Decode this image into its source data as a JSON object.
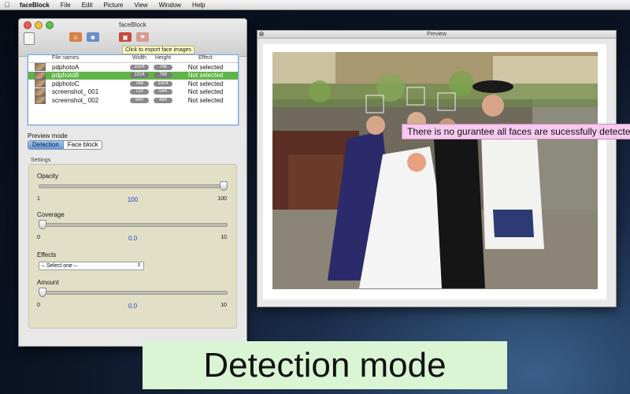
{
  "menubar": {
    "app_name": "faceBlock",
    "items": [
      "File",
      "Edit",
      "Picture",
      "View",
      "Window",
      "Help"
    ]
  },
  "main_window": {
    "title": "faceBlock",
    "tooltip": "Click to export face images",
    "table": {
      "headers": [
        "File names",
        "Width",
        "Height",
        "Effect"
      ],
      "rows": [
        {
          "name": "pdphotoA",
          "width": "1024",
          "height": "768",
          "effect": "Not selected"
        },
        {
          "name": "pdphotoB",
          "width": "1024",
          "height": "768",
          "effect": "Not selected"
        },
        {
          "name": "pdphotoC",
          "width": "768",
          "height": "1024",
          "effect": "Not selected"
        },
        {
          "name": "screenshot_ 001",
          "width": "720",
          "height": "544",
          "effect": "Not selected"
        },
        {
          "name": "screenshot_ 002",
          "width": "640",
          "height": "480",
          "effect": "Not selected"
        }
      ],
      "selected_row": 1
    },
    "preview_mode": {
      "label": "Preview mode",
      "options": [
        "Detection",
        "Face block"
      ],
      "active": "Detection"
    },
    "settings": {
      "label": "Settings",
      "opacity": {
        "label": "Opacity",
        "min": "1",
        "max": "100",
        "value": "100",
        "level": 1.0
      },
      "coverage": {
        "label": "Coverage",
        "min": "0",
        "max": "10",
        "value": "0.0",
        "level": 0.0
      },
      "effects": {
        "label": "Effects",
        "selected": "– Select one –"
      },
      "amount": {
        "label": "Amount",
        "min": "0",
        "max": "10",
        "value": "0.0",
        "level": 0.0
      }
    }
  },
  "preview_window": {
    "title": "Preview"
  },
  "callout": "There is no gurantee all faces are sucessfully detected",
  "banner": "Detection mode"
}
